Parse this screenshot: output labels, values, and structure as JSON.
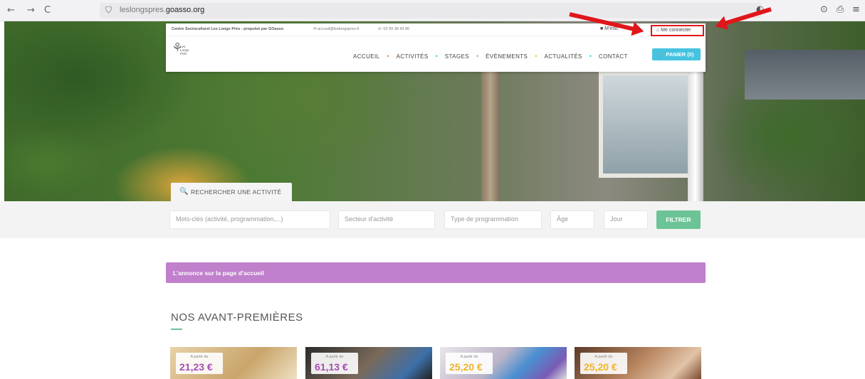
{
  "browser": {
    "back": "←",
    "forward": "→",
    "reload": "C",
    "shield": "⛉",
    "url_domain_prefix": "leslongspres.",
    "url_domain_main": "goasso.org",
    "ext_icon": "◐",
    "profile_icon": "⊙",
    "share_icon": "⎙",
    "menu_icon": "≡"
  },
  "topline": {
    "org": "Centre Socioculturel Les Longs Prés - propulsé par GOasso",
    "email": "✉ accueil@leslongspres.fr",
    "phone": "☏ 02 99 38 43 86",
    "signup": "■ M'insc",
    "login": "⌂ Me connecter"
  },
  "logo": {
    "text": "Les Longs Prés"
  },
  "menu": {
    "items": [
      "ACCUEIL",
      "ACTIVITÉS",
      "STAGES",
      "ÉVÈNEMENTS",
      "ACTUALITÉS",
      "CONTACT"
    ],
    "dot": "•",
    "dot_colors": [
      "#f0843c",
      "#45c3e0",
      "#6cc396",
      "#f0c23c",
      "#45c3e0"
    ],
    "cart": "🛒 PANIER (0)"
  },
  "search": {
    "tab_icon": "🔍",
    "tab_label": "RECHERCHER UNE ACTIVITÉ",
    "keywords_placeholder": "Mots-clés (activité, programmation,...)",
    "sector_placeholder": "Secteur d'activité",
    "type_placeholder": "Type de programmation",
    "age_placeholder": "Âge",
    "day_placeholder": "Jour",
    "filter_label": "FILTRER"
  },
  "announcement": {
    "text": "L'annonce sur la page d'accueil"
  },
  "section": {
    "title": "NOS AVANT-PREMIÈRES"
  },
  "cards": [
    {
      "from": "A partir de",
      "price": "21,23 €",
      "color": "#a64db3"
    },
    {
      "from": "A partir de",
      "price": "61,13 €",
      "color": "#a64db3"
    },
    {
      "from": "A partir de",
      "price": "25,20 €",
      "color": "#f0b429"
    },
    {
      "from": "A partir de",
      "price": "25,20 €",
      "color": "#f0b429"
    }
  ],
  "colors": {
    "accent_green": "#6cc396",
    "announce_purple": "#c080cc",
    "cart_blue": "#45c3e0",
    "highlight_red": "#e0161b"
  }
}
